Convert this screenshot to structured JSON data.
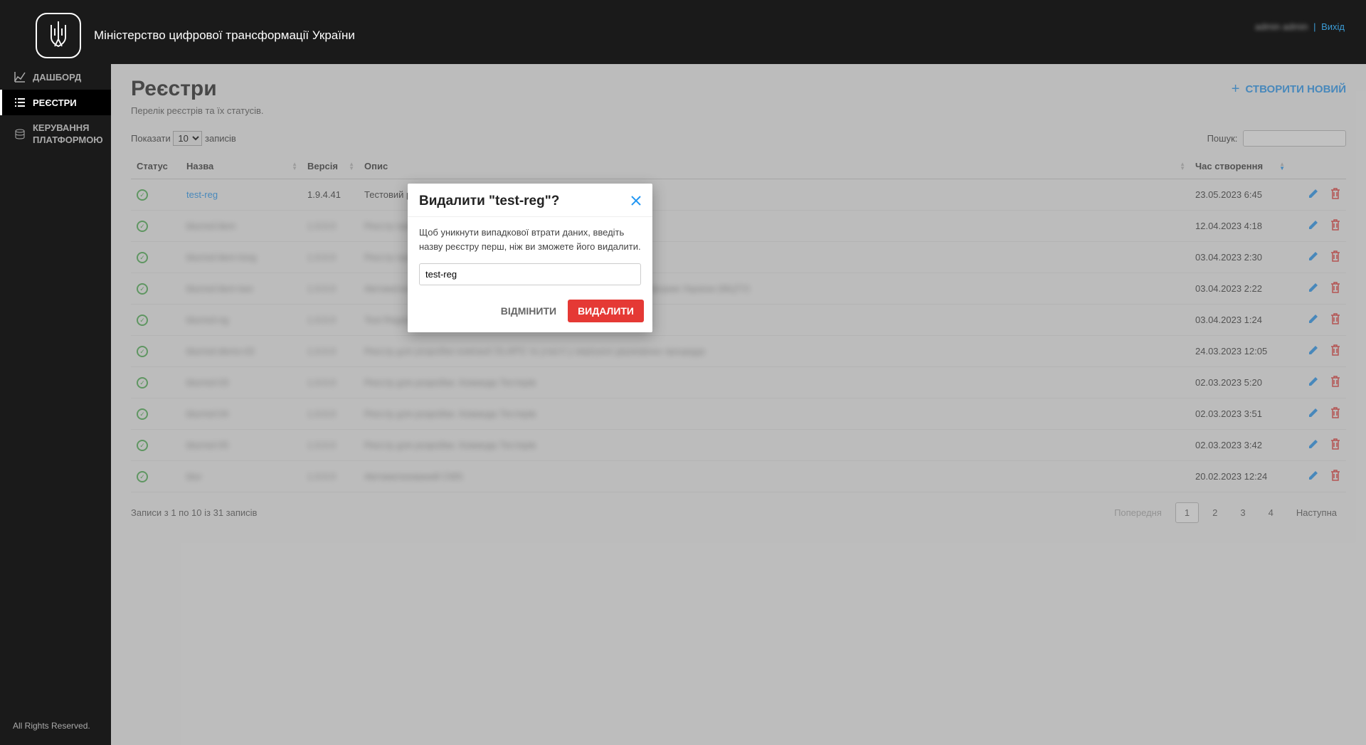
{
  "header": {
    "title": "Міністерство цифрової трансформації України",
    "user_blur": "admin admin",
    "logout": "Вихід"
  },
  "sidebar": {
    "items": [
      {
        "label": "ДАШБОРД"
      },
      {
        "label": "РЕЄСТРИ"
      },
      {
        "label": "КЕРУВАННЯ ПЛАТФОРМОЮ"
      }
    ]
  },
  "page": {
    "title": "Реєстри",
    "subtitle": "Перелік реєстрів та їх статусів.",
    "create_label": "СТВОРИТИ НОВИЙ"
  },
  "table_controls": {
    "show_prefix": "Показати",
    "page_size": "10",
    "show_suffix": "записів",
    "search_label": "Пошук:"
  },
  "columns": {
    "status": "Статус",
    "name": "Назва",
    "version": "Версія",
    "description": "Опис",
    "created": "Час створення"
  },
  "rows": [
    {
      "name": "test-reg",
      "version": "1.9.4.41",
      "description": "Тестовий реєстр",
      "created": "23.05.2023 6:45",
      "blurred": false
    },
    {
      "name": "blurred-item",
      "version": "1.0.0.0",
      "description": "Реєстр прикладний тестовий",
      "created": "12.04.2023 4:18",
      "blurred": true
    },
    {
      "name": "blurred-item-long",
      "version": "1.0.0.0",
      "description": "Реєстр прикладний тестовий",
      "created": "03.04.2023 2:30",
      "blurred": true
    },
    {
      "name": "blurred-item-two",
      "version": "1.0.0.0",
      "description": "Автоматизований реєстр для демонстрації роботи державної платформи України (МЦТУ)",
      "created": "03.04.2023 2:22",
      "blurred": true
    },
    {
      "name": "blurred-ng",
      "version": "1.0.0.0",
      "description": "Test Register",
      "created": "03.04.2023 1:24",
      "blurred": true
    },
    {
      "name": "blurred-demo-02",
      "version": "1.0.0.0",
      "description": "Реєстр для розробки компанії DLAPG та участі у вирішені державних процедур",
      "created": "24.03.2023 12:05",
      "blurred": true
    },
    {
      "name": "blurred-03",
      "version": "1.0.0.0",
      "description": "Реєстр для розробки. Команда Тестерів",
      "created": "02.03.2023 5:20",
      "blurred": true
    },
    {
      "name": "blurred-04",
      "version": "1.0.0.0",
      "description": "Реєстр для розробки. Команда Тестерів",
      "created": "02.03.2023 3:51",
      "blurred": true
    },
    {
      "name": "blurred-05",
      "version": "1.0.0.0",
      "description": "Реєстр для розробки. Команда Тестерів",
      "created": "02.03.2023 3:42",
      "blurred": true
    },
    {
      "name": "blur",
      "version": "1.0.0.0",
      "description": "Автоматизований CMS",
      "created": "20.02.2023 12:24",
      "blurred": true
    }
  ],
  "table_footer": {
    "info": "Записи з 1 по 10 із 31 записів",
    "prev": "Попередня",
    "pages": [
      "1",
      "2",
      "3",
      "4"
    ],
    "next": "Наступна"
  },
  "footer": "All Rights Reserved.",
  "modal": {
    "title": "Видалити \"test-reg\"?",
    "body": "Щоб уникнути випадкової втрати даних, введіть назву реєстру перш, ніж ви зможете його видалити.",
    "input_value": "test-reg",
    "cancel": "ВІДМІНИТИ",
    "confirm": "ВИДАЛИТИ"
  }
}
